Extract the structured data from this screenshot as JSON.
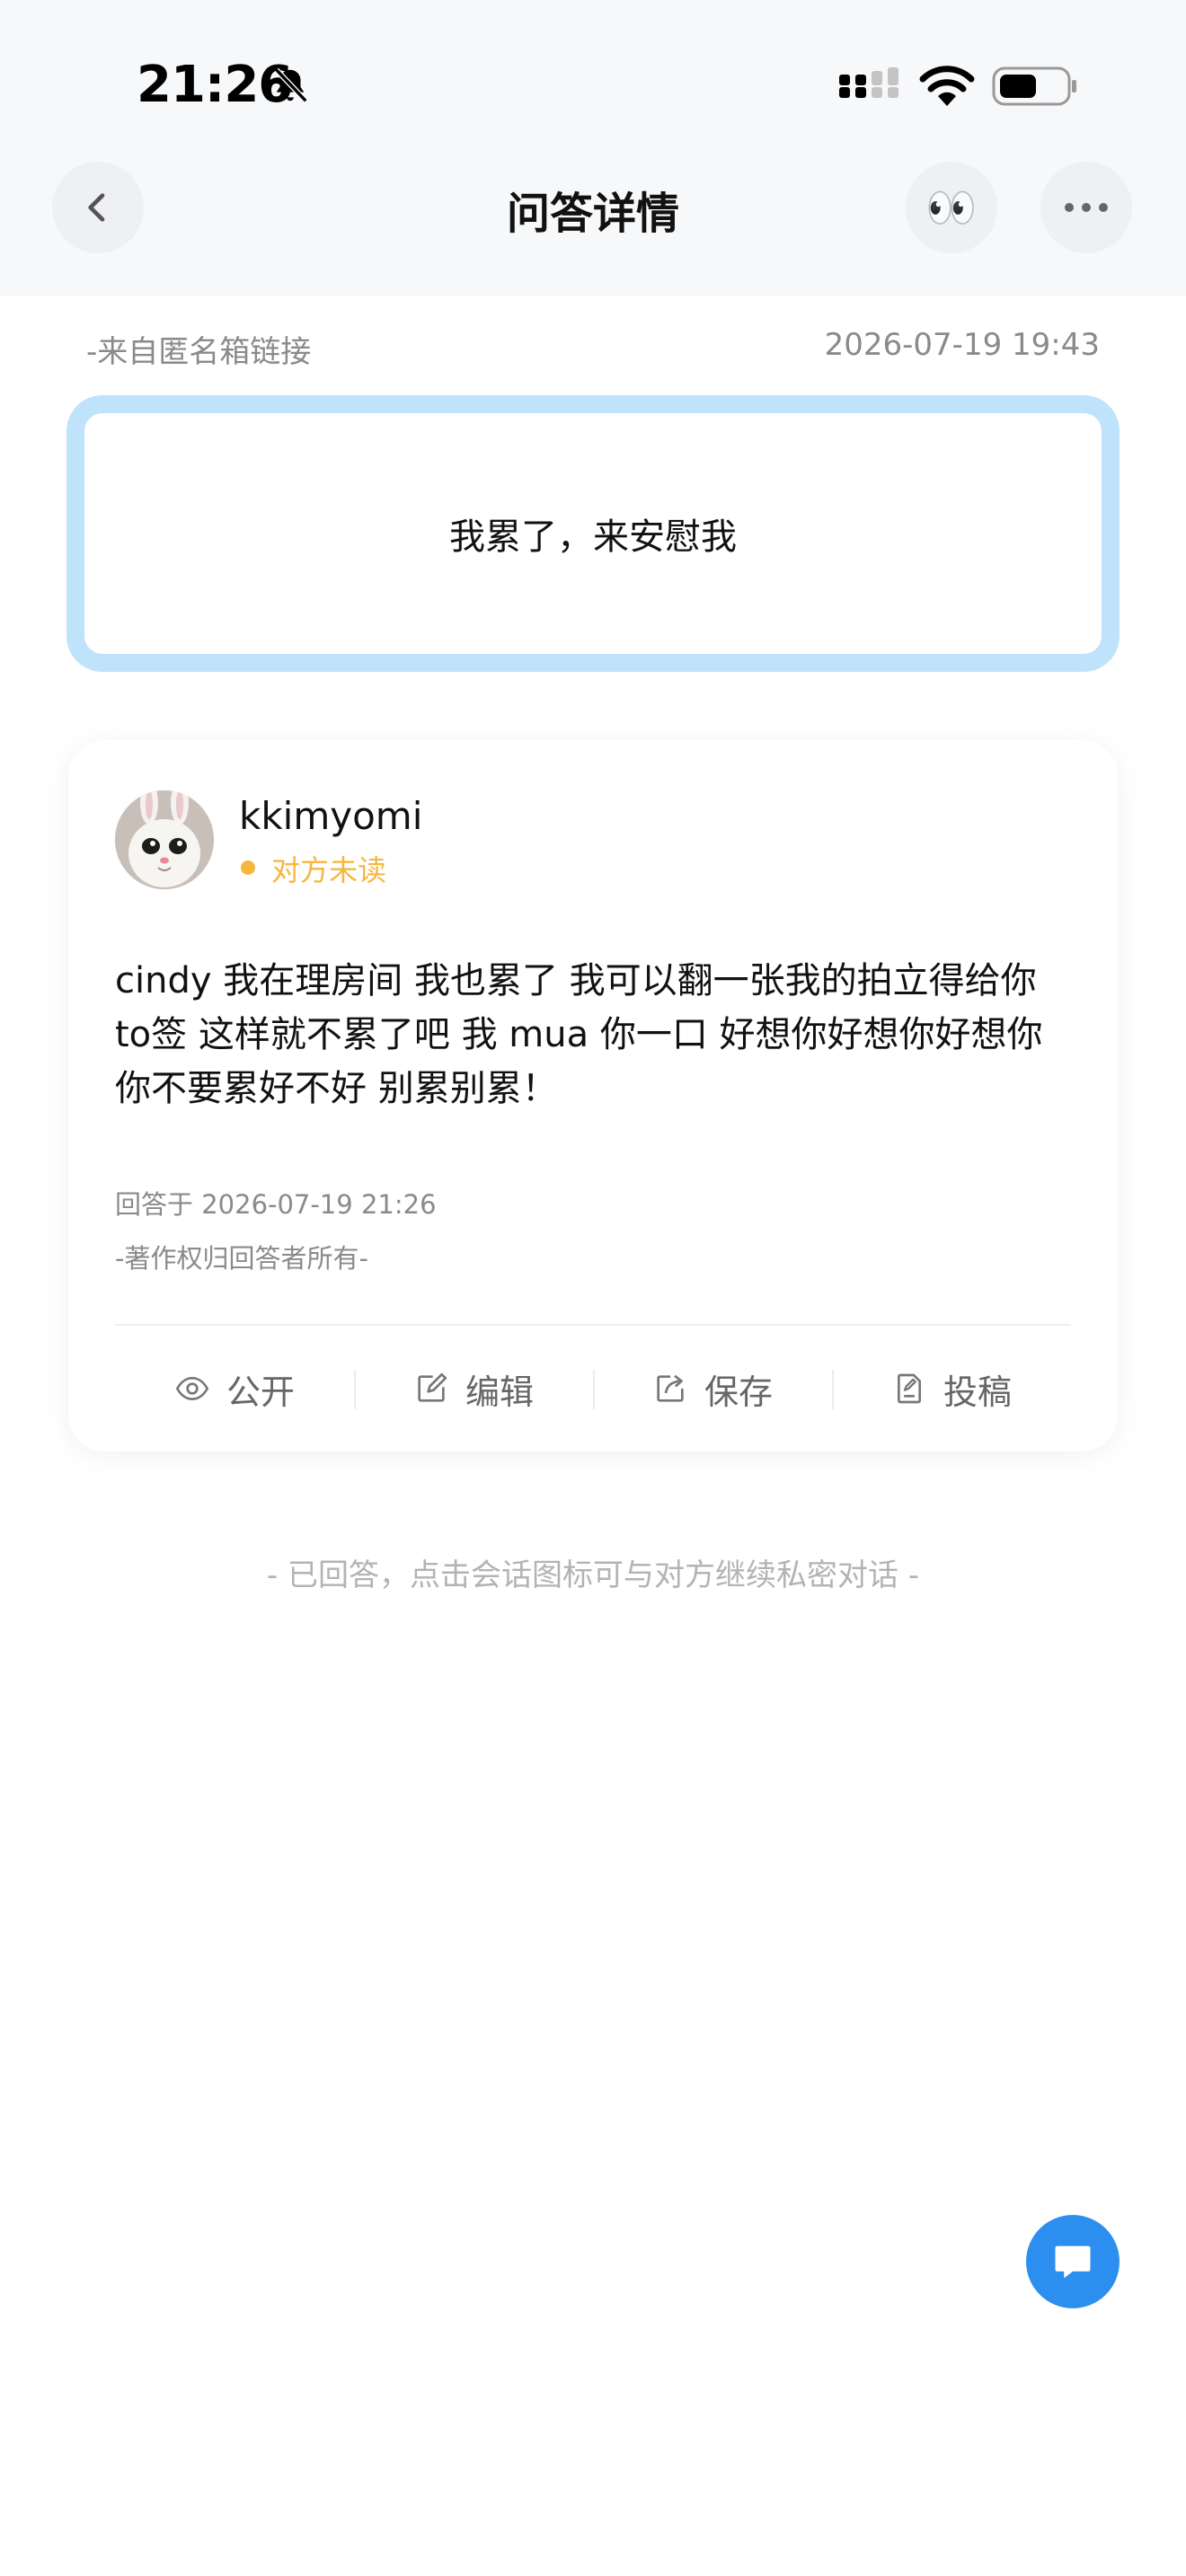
{
  "status_bar": {
    "time": "21:26"
  },
  "nav": {
    "title": "问答详情",
    "eyes_emoji": "👀"
  },
  "source": {
    "label": "-来自匿名箱链接",
    "time": "2026-07-19 19:43"
  },
  "question": {
    "text": "我累了，来安慰我"
  },
  "answer": {
    "username": "kkimyomi",
    "read_status": "对方未读",
    "text": "cindy 我在理房间 我也累了 我可以翻一张我的拍立得给你 to签 这样就不累了吧 我 mua 你一口 好想你好想你好想你 你不要累好不好 别累别累！",
    "answered_at": "回答于 2026-07-19 21:26",
    "copyright": "-著作权归回答者所有-",
    "actions": [
      {
        "label": "公开",
        "icon": "eye-icon"
      },
      {
        "label": "编辑",
        "icon": "edit-icon"
      },
      {
        "label": "保存",
        "icon": "share-save-icon"
      },
      {
        "label": "投稿",
        "icon": "submit-doc-icon"
      }
    ]
  },
  "footer": {
    "hint": "- 已回答，点击会话图标可与对方继续私密对话 -"
  },
  "colors": {
    "accent_blue": "#2c8fef",
    "question_border": "#bee3fa",
    "unread_orange": "#f5b740",
    "muted_text": "#8a8a8a"
  }
}
